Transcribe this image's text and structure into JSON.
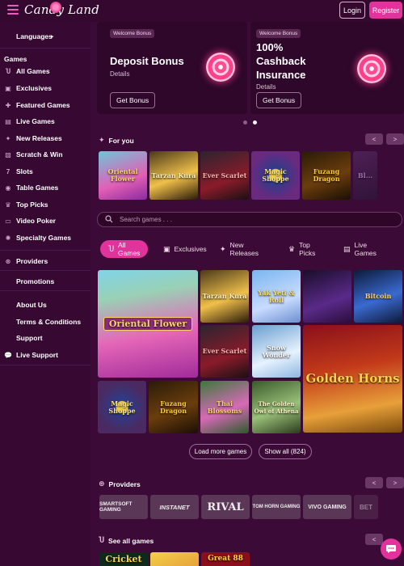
{
  "header": {
    "logo_text": "Candy Land",
    "login_label": "Login",
    "register_label": "Register"
  },
  "sidebar": {
    "languages_label": "Languages",
    "games_heading": "Games",
    "game_items": [
      {
        "label": "All Games",
        "icon": "horseshoe-icon"
      },
      {
        "label": "Exclusives",
        "icon": "exclusive-icon"
      },
      {
        "label": "Featured Games",
        "icon": "puzzle-icon"
      },
      {
        "label": "Live Games",
        "icon": "cards-icon"
      },
      {
        "label": "New Releases",
        "icon": "sparkle-icon"
      },
      {
        "label": "Scratch & Win",
        "icon": "scratch-icon"
      },
      {
        "label": "Slots",
        "icon": "seven-icon"
      },
      {
        "label": "Table Games",
        "icon": "table-icon"
      },
      {
        "label": "Top Picks",
        "icon": "trophy-icon"
      },
      {
        "label": "Video Poker",
        "icon": "poker-icon"
      },
      {
        "label": "Specialty Games",
        "icon": "gear-icon"
      }
    ],
    "providers_label": "Providers",
    "promotions_label": "Promotions",
    "about_label": "About Us",
    "terms_label": "Terms & Conditions",
    "support_label": "Support",
    "live_support_label": "Live Support"
  },
  "bonuses": [
    {
      "tag": "Welcome Bonus",
      "title": "Deposit Bonus",
      "details": "Details",
      "button": "Get Bonus"
    },
    {
      "tag": "Welcome Bonus",
      "title_line1": "100%",
      "title_line2": "Cashback",
      "title_line3": "Insurance",
      "details": "Details",
      "button": "Get Bonus"
    }
  ],
  "for_you": {
    "title": "For you",
    "prev": "<",
    "next": ">",
    "games": [
      "Oriental Flower",
      "Tarzan Kura",
      "Ever Scarlet",
      "Magic Shoppe",
      "Fuzang Dragon",
      "Bl..."
    ]
  },
  "search": {
    "placeholder": "Search games . . ."
  },
  "tabs": [
    {
      "label": "All Games",
      "icon": "horseshoe-icon"
    },
    {
      "label": "Exclusives",
      "icon": "exclusive-icon"
    },
    {
      "label": "New Releases",
      "icon": "sparkle-icon"
    },
    {
      "label": "Top Picks",
      "icon": "trophy-icon"
    },
    {
      "label": "Live Games",
      "icon": "cards-icon"
    }
  ],
  "grid_games": {
    "oriental": "Oriental Flower",
    "tarzan": "Tarzan Kura",
    "yak": "Yak Yeti & Roll",
    "g4": "",
    "g5": "Bitcoin",
    "scarlet": "Ever Scarlet",
    "snow": "Snow Wonder",
    "horns": "Golden Horns",
    "magic": "Magic Shoppe",
    "fuzang": "Fuzang Dragon",
    "thai": "Thai Blossoms",
    "athena": "The Golden Owl of Athena"
  },
  "buttons": {
    "load_more": "Load more games",
    "show_all": "Show all (824)"
  },
  "providers": {
    "title": "Providers",
    "items": [
      "SMARTSOFT GAMING",
      "INSTANET",
      "RIVAL",
      "TOM HORN GAMING",
      "VIVO GAMING",
      "BET"
    ]
  },
  "see_all": {
    "title": "See all games",
    "games": [
      "Cricket",
      "",
      "Great 88"
    ]
  }
}
